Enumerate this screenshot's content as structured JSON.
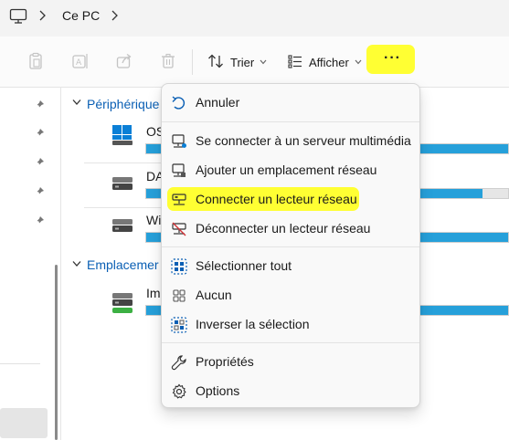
{
  "address": {
    "location": "Ce PC",
    "icons": [
      "monitor-icon",
      "chevron-right-icon"
    ]
  },
  "toolbar": {
    "sort_label": "Trier",
    "view_label": "Afficher",
    "more_label": "···",
    "highlight_color": "#ffff33"
  },
  "content": {
    "group1_label": "Périphérique",
    "group2_label": "Emplacemer",
    "drives": [
      {
        "label": "OS",
        "used_fraction": 1.0
      },
      {
        "label": "DA",
        "used_fraction": 0.93
      },
      {
        "label": "Wi",
        "used_fraction": 1.0
      },
      {
        "label": "Im",
        "used_fraction": 1.0
      }
    ],
    "bar_color": "#26a0da"
  },
  "menu": {
    "items": [
      {
        "label": "Annuler",
        "icon": "undo-icon"
      },
      {
        "label": "Se connecter à un serveur multimédia",
        "icon": "media-server-icon"
      },
      {
        "label": "Ajouter un emplacement réseau",
        "icon": "network-location-icon"
      },
      {
        "label": "Connecter un lecteur réseau",
        "icon": "map-network-drive-icon"
      },
      {
        "label": "Déconnecter un lecteur réseau",
        "icon": "disconnect-network-drive-icon"
      },
      {
        "label": "Sélectionner tout",
        "icon": "select-all-icon"
      },
      {
        "label": "Aucun",
        "icon": "select-none-icon"
      },
      {
        "label": "Inverser la sélection",
        "icon": "invert-selection-icon"
      },
      {
        "label": "Propriétés",
        "icon": "wrench-icon"
      },
      {
        "label": "Options",
        "icon": "gear-icon"
      }
    ]
  }
}
